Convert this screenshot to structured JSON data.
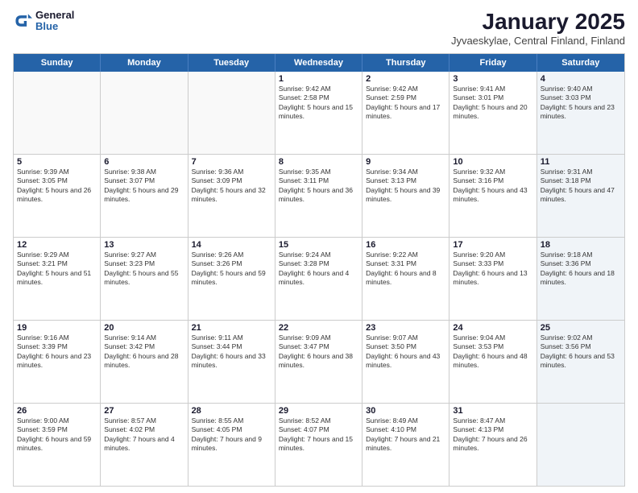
{
  "logo": {
    "general": "General",
    "blue": "Blue"
  },
  "title": "January 2025",
  "subtitle": "Jyvaeskylae, Central Finland, Finland",
  "days": [
    "Sunday",
    "Monday",
    "Tuesday",
    "Wednesday",
    "Thursday",
    "Friday",
    "Saturday"
  ],
  "rows": [
    [
      {
        "day": "",
        "sunrise": "",
        "sunset": "",
        "daylight": "",
        "empty": true
      },
      {
        "day": "",
        "sunrise": "",
        "sunset": "",
        "daylight": "",
        "empty": true
      },
      {
        "day": "",
        "sunrise": "",
        "sunset": "",
        "daylight": "",
        "empty": true
      },
      {
        "day": "1",
        "sunrise": "Sunrise: 9:42 AM",
        "sunset": "Sunset: 2:58 PM",
        "daylight": "Daylight: 5 hours and 15 minutes.",
        "empty": false
      },
      {
        "day": "2",
        "sunrise": "Sunrise: 9:42 AM",
        "sunset": "Sunset: 2:59 PM",
        "daylight": "Daylight: 5 hours and 17 minutes.",
        "empty": false
      },
      {
        "day": "3",
        "sunrise": "Sunrise: 9:41 AM",
        "sunset": "Sunset: 3:01 PM",
        "daylight": "Daylight: 5 hours and 20 minutes.",
        "empty": false
      },
      {
        "day": "4",
        "sunrise": "Sunrise: 9:40 AM",
        "sunset": "Sunset: 3:03 PM",
        "daylight": "Daylight: 5 hours and 23 minutes.",
        "empty": false,
        "shaded": true
      }
    ],
    [
      {
        "day": "5",
        "sunrise": "Sunrise: 9:39 AM",
        "sunset": "Sunset: 3:05 PM",
        "daylight": "Daylight: 5 hours and 26 minutes.",
        "empty": false
      },
      {
        "day": "6",
        "sunrise": "Sunrise: 9:38 AM",
        "sunset": "Sunset: 3:07 PM",
        "daylight": "Daylight: 5 hours and 29 minutes.",
        "empty": false
      },
      {
        "day": "7",
        "sunrise": "Sunrise: 9:36 AM",
        "sunset": "Sunset: 3:09 PM",
        "daylight": "Daylight: 5 hours and 32 minutes.",
        "empty": false
      },
      {
        "day": "8",
        "sunrise": "Sunrise: 9:35 AM",
        "sunset": "Sunset: 3:11 PM",
        "daylight": "Daylight: 5 hours and 36 minutes.",
        "empty": false
      },
      {
        "day": "9",
        "sunrise": "Sunrise: 9:34 AM",
        "sunset": "Sunset: 3:13 PM",
        "daylight": "Daylight: 5 hours and 39 minutes.",
        "empty": false
      },
      {
        "day": "10",
        "sunrise": "Sunrise: 9:32 AM",
        "sunset": "Sunset: 3:16 PM",
        "daylight": "Daylight: 5 hours and 43 minutes.",
        "empty": false
      },
      {
        "day": "11",
        "sunrise": "Sunrise: 9:31 AM",
        "sunset": "Sunset: 3:18 PM",
        "daylight": "Daylight: 5 hours and 47 minutes.",
        "empty": false,
        "shaded": true
      }
    ],
    [
      {
        "day": "12",
        "sunrise": "Sunrise: 9:29 AM",
        "sunset": "Sunset: 3:21 PM",
        "daylight": "Daylight: 5 hours and 51 minutes.",
        "empty": false
      },
      {
        "day": "13",
        "sunrise": "Sunrise: 9:27 AM",
        "sunset": "Sunset: 3:23 PM",
        "daylight": "Daylight: 5 hours and 55 minutes.",
        "empty": false
      },
      {
        "day": "14",
        "sunrise": "Sunrise: 9:26 AM",
        "sunset": "Sunset: 3:26 PM",
        "daylight": "Daylight: 5 hours and 59 minutes.",
        "empty": false
      },
      {
        "day": "15",
        "sunrise": "Sunrise: 9:24 AM",
        "sunset": "Sunset: 3:28 PM",
        "daylight": "Daylight: 6 hours and 4 minutes.",
        "empty": false
      },
      {
        "day": "16",
        "sunrise": "Sunrise: 9:22 AM",
        "sunset": "Sunset: 3:31 PM",
        "daylight": "Daylight: 6 hours and 8 minutes.",
        "empty": false
      },
      {
        "day": "17",
        "sunrise": "Sunrise: 9:20 AM",
        "sunset": "Sunset: 3:33 PM",
        "daylight": "Daylight: 6 hours and 13 minutes.",
        "empty": false
      },
      {
        "day": "18",
        "sunrise": "Sunrise: 9:18 AM",
        "sunset": "Sunset: 3:36 PM",
        "daylight": "Daylight: 6 hours and 18 minutes.",
        "empty": false,
        "shaded": true
      }
    ],
    [
      {
        "day": "19",
        "sunrise": "Sunrise: 9:16 AM",
        "sunset": "Sunset: 3:39 PM",
        "daylight": "Daylight: 6 hours and 23 minutes.",
        "empty": false
      },
      {
        "day": "20",
        "sunrise": "Sunrise: 9:14 AM",
        "sunset": "Sunset: 3:42 PM",
        "daylight": "Daylight: 6 hours and 28 minutes.",
        "empty": false
      },
      {
        "day": "21",
        "sunrise": "Sunrise: 9:11 AM",
        "sunset": "Sunset: 3:44 PM",
        "daylight": "Daylight: 6 hours and 33 minutes.",
        "empty": false
      },
      {
        "day": "22",
        "sunrise": "Sunrise: 9:09 AM",
        "sunset": "Sunset: 3:47 PM",
        "daylight": "Daylight: 6 hours and 38 minutes.",
        "empty": false
      },
      {
        "day": "23",
        "sunrise": "Sunrise: 9:07 AM",
        "sunset": "Sunset: 3:50 PM",
        "daylight": "Daylight: 6 hours and 43 minutes.",
        "empty": false
      },
      {
        "day": "24",
        "sunrise": "Sunrise: 9:04 AM",
        "sunset": "Sunset: 3:53 PM",
        "daylight": "Daylight: 6 hours and 48 minutes.",
        "empty": false
      },
      {
        "day": "25",
        "sunrise": "Sunrise: 9:02 AM",
        "sunset": "Sunset: 3:56 PM",
        "daylight": "Daylight: 6 hours and 53 minutes.",
        "empty": false,
        "shaded": true
      }
    ],
    [
      {
        "day": "26",
        "sunrise": "Sunrise: 9:00 AM",
        "sunset": "Sunset: 3:59 PM",
        "daylight": "Daylight: 6 hours and 59 minutes.",
        "empty": false
      },
      {
        "day": "27",
        "sunrise": "Sunrise: 8:57 AM",
        "sunset": "Sunset: 4:02 PM",
        "daylight": "Daylight: 7 hours and 4 minutes.",
        "empty": false
      },
      {
        "day": "28",
        "sunrise": "Sunrise: 8:55 AM",
        "sunset": "Sunset: 4:05 PM",
        "daylight": "Daylight: 7 hours and 9 minutes.",
        "empty": false
      },
      {
        "day": "29",
        "sunrise": "Sunrise: 8:52 AM",
        "sunset": "Sunset: 4:07 PM",
        "daylight": "Daylight: 7 hours and 15 minutes.",
        "empty": false
      },
      {
        "day": "30",
        "sunrise": "Sunrise: 8:49 AM",
        "sunset": "Sunset: 4:10 PM",
        "daylight": "Daylight: 7 hours and 21 minutes.",
        "empty": false
      },
      {
        "day": "31",
        "sunrise": "Sunrise: 8:47 AM",
        "sunset": "Sunset: 4:13 PM",
        "daylight": "Daylight: 7 hours and 26 minutes.",
        "empty": false
      },
      {
        "day": "",
        "sunrise": "",
        "sunset": "",
        "daylight": "",
        "empty": true,
        "shaded": true
      }
    ]
  ]
}
